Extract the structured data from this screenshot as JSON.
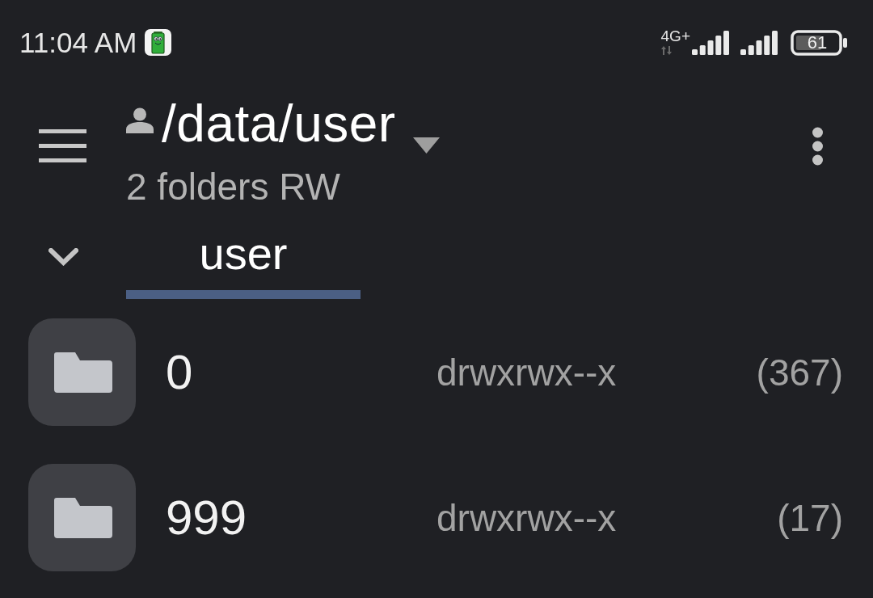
{
  "status_bar": {
    "time": "11:04 AM",
    "network_type": "4G+",
    "battery_percent": "61"
  },
  "header": {
    "title": "/data/user",
    "subtitle": "2 folders RW"
  },
  "tabs": [
    {
      "label": "user",
      "selected": true
    }
  ],
  "files": [
    {
      "name": "0",
      "permissions": "drwxrwx--x",
      "count": "(367)"
    },
    {
      "name": "999",
      "permissions": "drwxrwx--x",
      "count": "(17)"
    }
  ]
}
